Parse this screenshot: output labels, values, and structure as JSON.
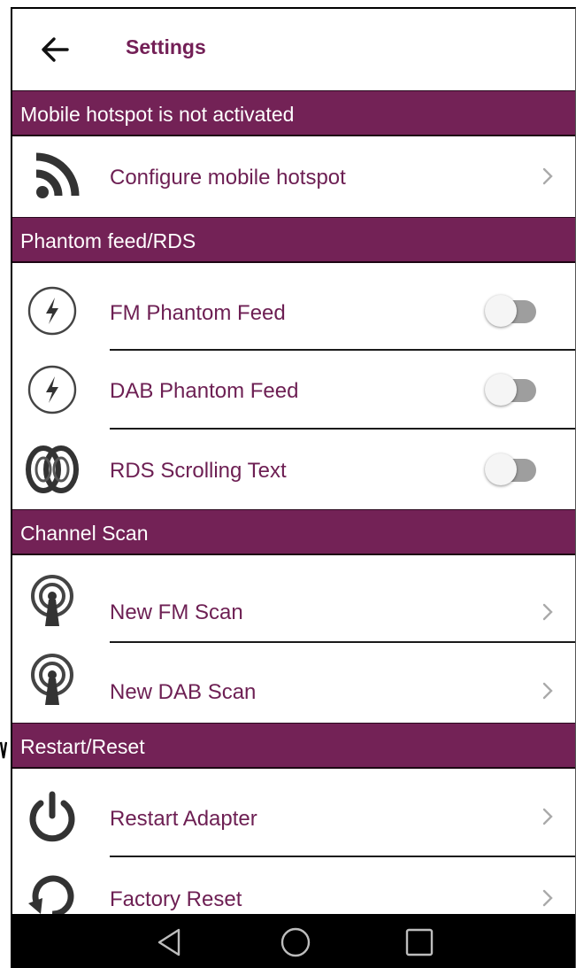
{
  "appbar": {
    "title": "Settings",
    "back_icon": "arrow-left-icon"
  },
  "sections": {
    "hotspot": {
      "header": "Mobile hotspot is not activated",
      "configure": {
        "label": "Configure mobile hotspot",
        "icon": "wifi-signal-icon"
      }
    },
    "phantom": {
      "header": "Phantom feed/RDS",
      "fm_phantom": {
        "label": "FM Phantom Feed",
        "icon": "lightning-circle-icon",
        "enabled": false
      },
      "dab_phantom": {
        "label": "DAB Phantom Feed",
        "icon": "lightning-circle-icon",
        "enabled": false
      },
      "rds_scroll": {
        "label": "RDS Scrolling Text",
        "icon": "rds-logo-icon",
        "enabled": false
      }
    },
    "scan": {
      "header": "Channel Scan",
      "new_fm": {
        "label": "New FM Scan",
        "icon": "antenna-icon"
      },
      "new_dab": {
        "label": "New DAB Scan",
        "icon": "antenna-icon"
      }
    },
    "reset": {
      "header": "Restart/Reset",
      "restart": {
        "label": "Restart Adapter",
        "icon": "power-icon"
      },
      "factory": {
        "label": "Factory Reset",
        "icon": "reset-icon"
      }
    }
  },
  "colors": {
    "accent": "#732256",
    "label": "#6d1f53",
    "toggle_off_track": "#9e9e9e",
    "navbar": "#000000"
  },
  "navbar": {
    "back": "nav-back-icon",
    "home": "nav-home-icon",
    "recents": "nav-recents-icon"
  }
}
